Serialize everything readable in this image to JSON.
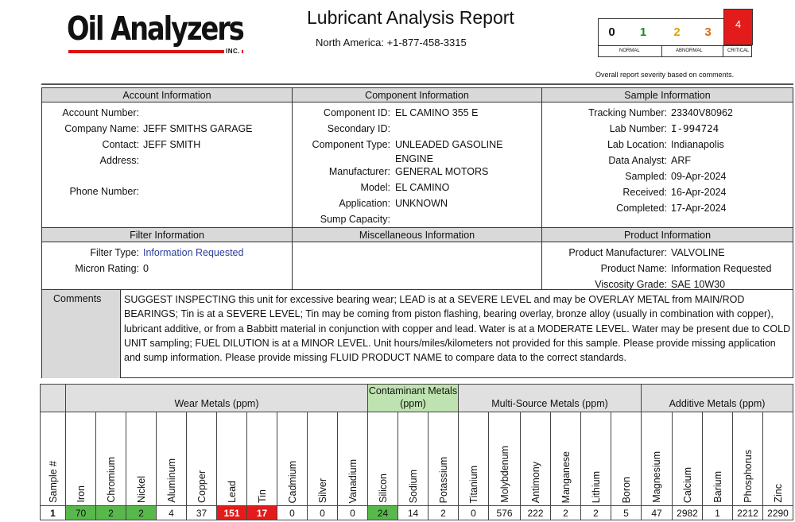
{
  "header": {
    "logo_text": "Oil Analyzers",
    "logo_inc": "INC.",
    "title": "Lubricant Analysis Report",
    "phone": "North America:  +1-877-458-3315"
  },
  "severity": {
    "levels": [
      "0",
      "1",
      "2",
      "3",
      "4"
    ],
    "labels": {
      "normal": "NORMAL",
      "abnormal": "ABNORMAL",
      "critical": "CRITICAL"
    },
    "current": "4",
    "note": "Overall report severity based on comments.",
    "colors": {
      "normal": "#111111",
      "green": "#1a8a1a",
      "yellow": "#d9a400",
      "orange": "#e06a10",
      "critical": "#e31b1b"
    }
  },
  "account": {
    "heading": "Account Information",
    "labels": [
      "Account Number:",
      "Company Name:",
      "Contact:",
      "Address:",
      "Phone Number:"
    ],
    "company": "JEFF SMITHS GARAGE",
    "contact": "JEFF SMITH"
  },
  "component": {
    "heading": "Component Information",
    "labels": [
      "Component ID:",
      "Secondary ID:",
      "Component Type:",
      "Manufacturer:",
      "Model:",
      "Application:",
      "Sump Capacity:"
    ],
    "component_id": "EL CAMINO 355 E",
    "type_line1": "UNLEADED GASOLINE",
    "type_line2": "ENGINE",
    "manufacturer": "GENERAL MOTORS",
    "model": "EL CAMINO",
    "application": "UNKNOWN"
  },
  "sample": {
    "heading": "Sample Information",
    "labels": [
      "Tracking Number:",
      "Lab Number:",
      "Lab Location:",
      "Data Analyst:",
      "Sampled:",
      "Received:",
      "Completed:"
    ],
    "tracking": "23340V80962",
    "lab_number": "I-994724",
    "lab_location": "Indianapolis",
    "analyst": "ARF",
    "sampled": "09-Apr-2024",
    "received": "16-Apr-2024",
    "completed": "17-Apr-2024"
  },
  "filter": {
    "heading": "Filter Information",
    "labels": [
      "Filter Type:",
      "Micron Rating:"
    ],
    "filter_type": "Information Requested",
    "micron": "0"
  },
  "misc": {
    "heading": "Miscellaneous Information"
  },
  "product": {
    "heading": "Product Information",
    "labels": [
      "Product Manufacturer:",
      "Product Name:",
      "Viscosity Grade:"
    ],
    "manufacturer": "VALVOLINE",
    "name": "Information Requested",
    "viscosity": "SAE 10W30"
  },
  "comments": {
    "label": "Comments",
    "text": "SUGGEST INSPECTING this unit for excessive bearing wear; LEAD is at a SEVERE LEVEL and may be OVERLAY METAL from MAIN/ROD BEARINGS; Tin is at a SEVERE LEVEL; Tin may be coming from piston flashing, bearing overlay, bronze alloy (usually in combination with copper), lubricant additive, or from a Babbitt material in conjunction with copper and lead. Water is at a MODERATE LEVEL. Water may be present due to COLD UNIT sampling; FUEL DILUTION is at a MINOR LEVEL. Unit hours/miles/kilometers not provided for this sample. Please provide missing application and sump information. Please provide missing FLUID PRODUCT NAME to compare data to the correct standards."
  },
  "metals": {
    "groups": [
      "Wear Metals (ppm)",
      "Contaminant Metals (ppm)",
      "Multi-Source Metals (ppm)",
      "Additive Metals (ppm)"
    ],
    "columns": [
      "Sample #",
      "Iron",
      "Chromium",
      "Nickel",
      "Aluminum",
      "Copper",
      "Lead",
      "Tin",
      "Cadmium",
      "Silver",
      "Vanadium",
      "Silicon",
      "Sodium",
      "Potassium",
      "Titanium",
      "Molybdenum",
      "Antimony",
      "Manganese",
      "Lithium",
      "Boron",
      "Magnesium",
      "Calcium",
      "Barium",
      "Phosphorus",
      "Zinc"
    ],
    "values": [
      "1",
      "70",
      "2",
      "2",
      "4",
      "37",
      "151",
      "17",
      "0",
      "0",
      "0",
      "24",
      "14",
      "2",
      "0",
      "576",
      "222",
      "2",
      "2",
      "5",
      "47",
      "2982",
      "1",
      "2212",
      "2290"
    ],
    "status": [
      "bold",
      "green",
      "green",
      "green",
      "",
      "",
      "red",
      "red",
      "",
      "",
      "",
      "green",
      "",
      "",
      "",
      "",
      "",
      "",
      "",
      "",
      "",
      "",
      "",
      "",
      ""
    ]
  }
}
